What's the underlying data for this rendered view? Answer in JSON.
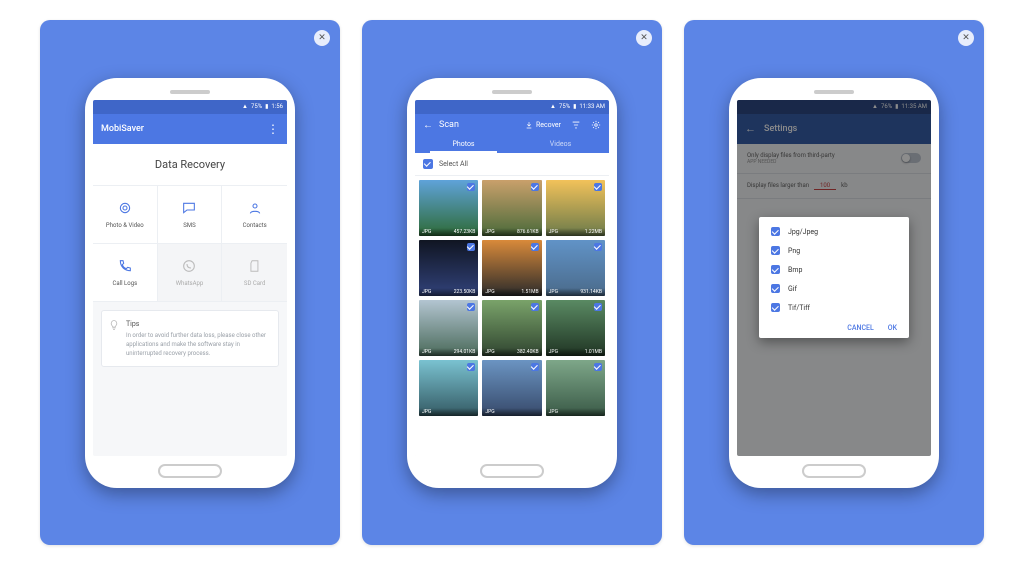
{
  "screen1": {
    "status": {
      "battery": "75%",
      "time": "1:56"
    },
    "appbar_title": "MobiSaver",
    "hero_title": "Data Recovery",
    "cells": [
      {
        "label": "Photo & Video"
      },
      {
        "label": "SMS"
      },
      {
        "label": "Contacts"
      },
      {
        "label": "Call Logs"
      },
      {
        "label": "WhatsApp"
      },
      {
        "label": "SD Card"
      }
    ],
    "tips": {
      "label": "Tips",
      "body": "In order to avoid further data loss, please close other applications and make the software stay in uninterrupted recovery process."
    }
  },
  "screen2": {
    "status": {
      "battery": "75%",
      "time": "11:33 AM"
    },
    "appbar_title": "Scan",
    "recover_label": "Recover",
    "tabs": {
      "photos": "Photos",
      "videos": "Videos"
    },
    "select_all": "Select All",
    "thumbs": [
      {
        "fmt": "JPG",
        "size": "457.23KB"
      },
      {
        "fmt": "JPG",
        "size": "876.61KB"
      },
      {
        "fmt": "JPG",
        "size": "1.22MB"
      },
      {
        "fmt": "JPG",
        "size": "223.50KB"
      },
      {
        "fmt": "JPG",
        "size": "1.51MB"
      },
      {
        "fmt": "JPG",
        "size": "931.14KB"
      },
      {
        "fmt": "JPG",
        "size": "294.01KB"
      },
      {
        "fmt": "JPG",
        "size": "382.40KB"
      },
      {
        "fmt": "JPG",
        "size": "1.01MB"
      },
      {
        "fmt": "JPG",
        "size": ""
      },
      {
        "fmt": "JPG",
        "size": ""
      },
      {
        "fmt": "JPG",
        "size": ""
      }
    ]
  },
  "screen3": {
    "status": {
      "battery": "76%",
      "time": "11:35 AM"
    },
    "appbar_title": "Settings",
    "row1": {
      "title": "Only display files from third-party",
      "subtitle": "APP NEEDED"
    },
    "row2": {
      "label": "Display files larger than",
      "value": "100",
      "unit": "kb"
    },
    "dialog": {
      "options": [
        {
          "label": "Jpg/Jpeg"
        },
        {
          "label": "Png"
        },
        {
          "label": "Bmp"
        },
        {
          "label": "Gif"
        },
        {
          "label": "Tif/Tiff"
        }
      ],
      "cancel": "CANCEL",
      "ok": "OK"
    }
  }
}
